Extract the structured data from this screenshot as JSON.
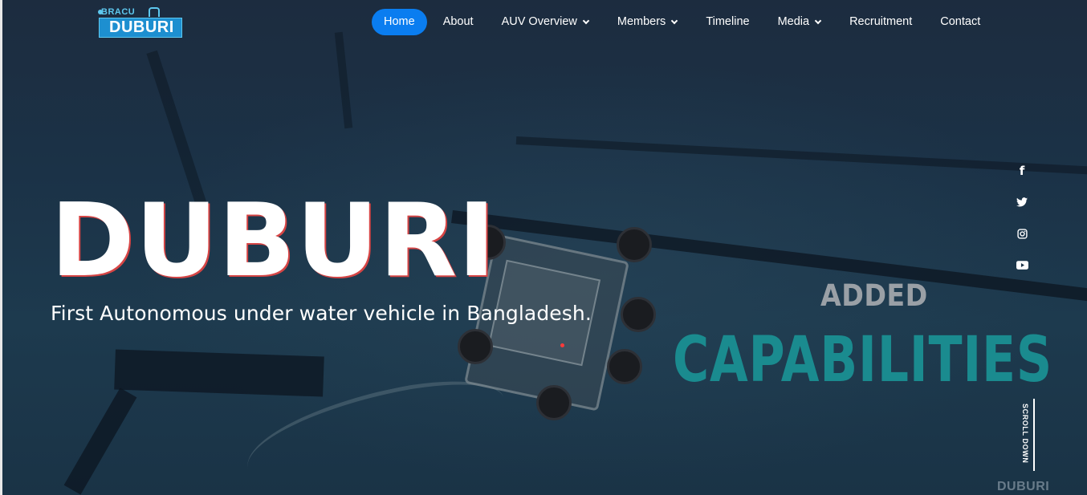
{
  "logo": {
    "top_text": "BRACU",
    "main_text": "DUBURI"
  },
  "nav": {
    "items": [
      {
        "label": "Home",
        "active": true,
        "dropdown": false
      },
      {
        "label": "About",
        "active": false,
        "dropdown": false
      },
      {
        "label": "AUV Overview",
        "active": false,
        "dropdown": true
      },
      {
        "label": "Members",
        "active": false,
        "dropdown": true
      },
      {
        "label": "Timeline",
        "active": false,
        "dropdown": false
      },
      {
        "label": "Media",
        "active": false,
        "dropdown": true
      },
      {
        "label": "Recruitment",
        "active": false,
        "dropdown": false
      },
      {
        "label": "Contact",
        "active": false,
        "dropdown": false
      }
    ]
  },
  "hero": {
    "title": "DUBURI",
    "subtitle": "First Autonomous under water vehicle in Bangladesh.",
    "video_overlay": {
      "line1": "ADDED",
      "line2": "CAPABILITIES",
      "watermark": "DUBURI"
    }
  },
  "social": [
    "facebook-icon",
    "twitter-icon",
    "instagram-icon",
    "youtube-icon"
  ],
  "scroll_label": "SCROLL DOWN",
  "colors": {
    "accent": "#0a7df0",
    "title_shadow": "#d64545",
    "overlay_teal": "#1a8b8f"
  }
}
